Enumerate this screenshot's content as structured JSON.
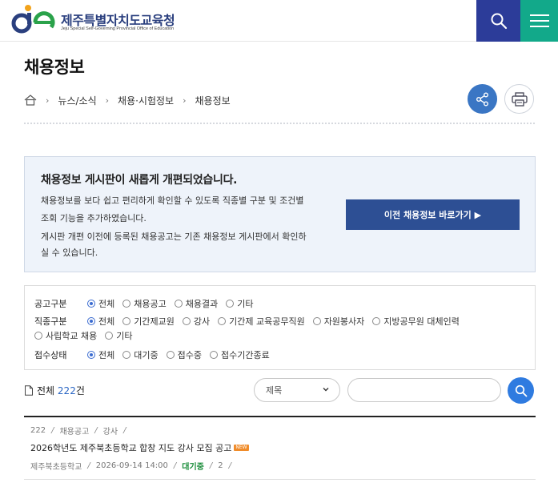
{
  "header": {
    "logo_title": "제주특별자치도교육청",
    "logo_sub": "Jeju Special Self-Governing Provincial Office of Education",
    "colors": {
      "search_bg": "#2c3c99",
      "menu_bg": "#12a98a"
    }
  },
  "page": {
    "title": "채용정보",
    "breadcrumb": [
      "뉴스/소식",
      "채용·시험정보",
      "채용정보"
    ]
  },
  "notice": {
    "title": "채용정보 게시판이 새롭게 개편되었습니다.",
    "lines": [
      "채용정보를 보다 쉽고 편리하게 확인할 수 있도록 직종별 구분 및 조건별",
      "조회 기능을 추가하였습니다.",
      "게시판 개편 이전에 등록된 채용공고는 기존 채용정보 게시판에서 확인하",
      "실 수 있습니다."
    ],
    "button_label": "이전 채용정보 바로가기 ▶"
  },
  "filters": {
    "notice_type": {
      "label": "공고구분",
      "options": [
        "전체",
        "채용공고",
        "채용결과",
        "기타"
      ],
      "selected": "전체"
    },
    "job_type": {
      "label": "직종구분",
      "options": [
        "전체",
        "기간제교원",
        "강사",
        "기간제 교육공무직원",
        "자원봉사자",
        "지방공무원 대체인력",
        "사립학교 채용",
        "기타"
      ],
      "selected": "전체"
    },
    "status": {
      "label": "접수상태",
      "options": [
        "전체",
        "대기중",
        "접수중",
        "접수기간종료"
      ],
      "selected": "전체"
    }
  },
  "listing": {
    "total_label": "전체",
    "total_count": "222",
    "total_unit": "건",
    "search_field_selected": "제목",
    "search_placeholder": ""
  },
  "posts": [
    {
      "number": "222",
      "category": "채용공고",
      "job": "강사",
      "title": "2026학년도 제주북초등학교 합창 지도 강사 모집 공고",
      "badge": "NEW",
      "school": "제주북초등학교",
      "date": "2026-09-14 14:00",
      "status": "대기중",
      "views": "2"
    }
  ]
}
